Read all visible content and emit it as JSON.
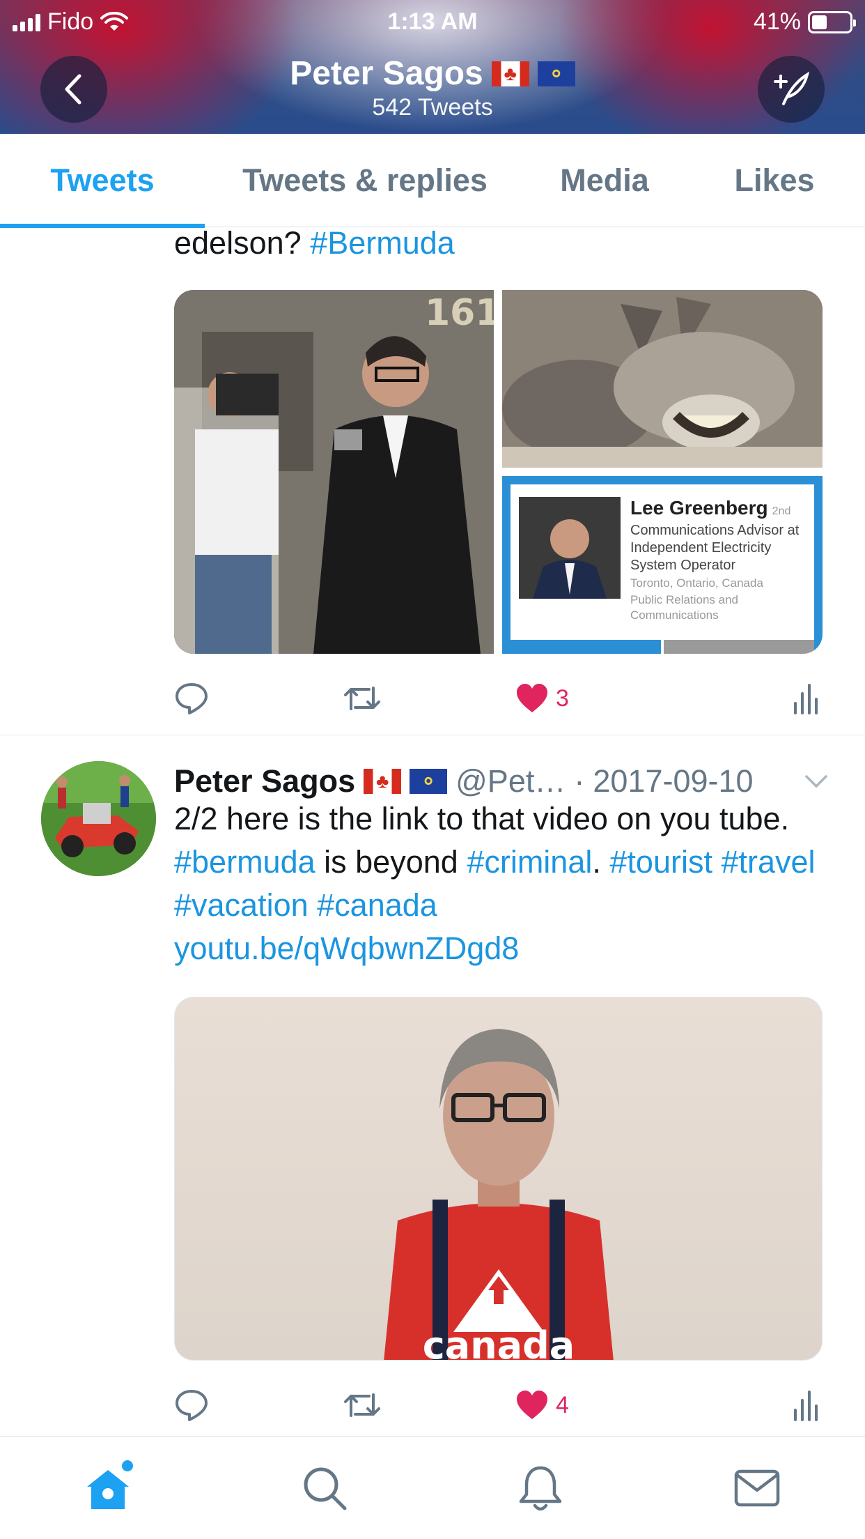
{
  "status_bar": {
    "carrier": "Fido",
    "time": "1:13 AM",
    "battery": "41%",
    "battery_level": 0.41
  },
  "header": {
    "name": "Peter Sagos",
    "tweet_count": "542 Tweets",
    "back_icon": "chevron-left-icon",
    "compose_icon": "compose-tweet-icon"
  },
  "tabs": [
    {
      "label": "Tweets",
      "active": true
    },
    {
      "label": "Tweets & replies",
      "active": false
    },
    {
      "label": "Media",
      "active": false
    },
    {
      "label": "Likes",
      "active": false
    }
  ],
  "tweet1": {
    "text_fragment": "edelson?",
    "hashtag": "#Bermuda",
    "image_number": "161",
    "profile_card": {
      "name": "Lee Greenberg",
      "degree": "2nd",
      "title": "Communications Advisor at Independent Electricity System Operator",
      "location": "Toronto, Ontario, Canada",
      "industry": "Public Relations and Communications"
    },
    "likes": "3"
  },
  "tweet2": {
    "name": "Peter Sagos",
    "handle": "@Pet…",
    "separator": "·",
    "date": "2017-09-10",
    "text_line1_a": "2/2 here is the link to that video on you tube.",
    "tag_bermuda": "#bermuda",
    "text_is_beyond": "is beyond",
    "tag_criminal": "#criminal",
    "period": ".",
    "tag_tourist": "#tourist",
    "tag_travel": "#travel",
    "tag_vacation": "#vacation",
    "tag_canada": "#canada",
    "link": "youtu.be/qWqbwnZDgd8",
    "shirt_text": "canada",
    "likes": "4"
  },
  "colors": {
    "accent": "#1da1f2",
    "link": "#1b95e0",
    "like": "#e0245e",
    "muted": "#657786"
  }
}
